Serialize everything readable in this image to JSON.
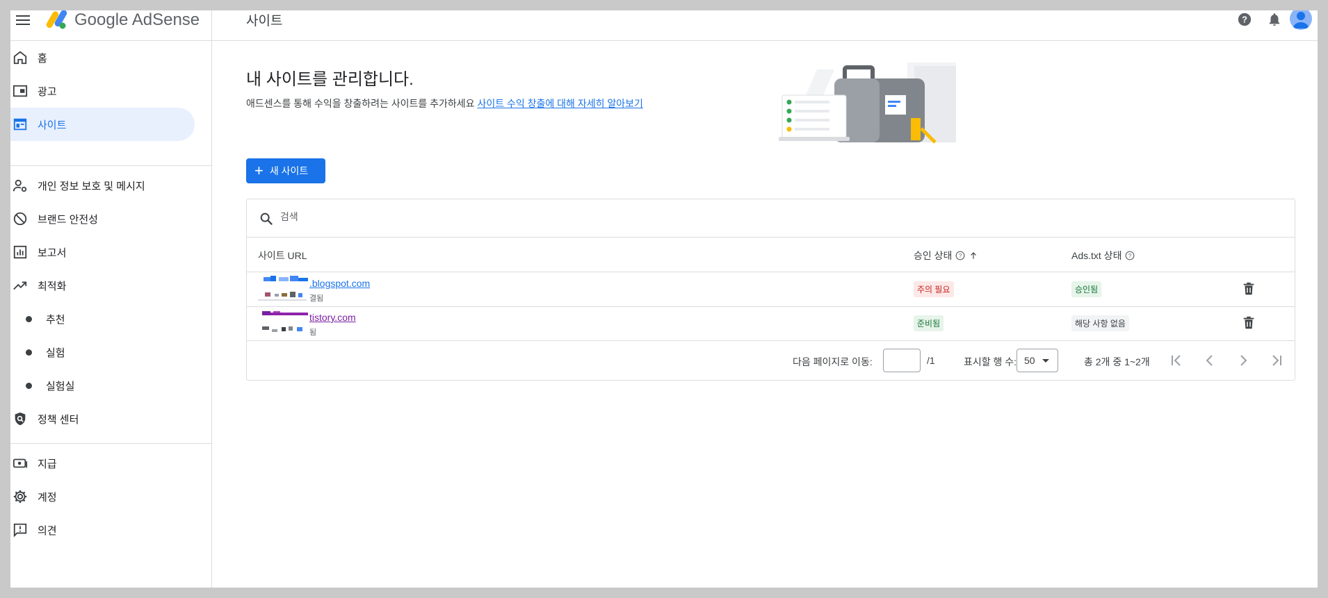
{
  "header": {
    "app_name": "Google AdSense",
    "page_title": "사이트"
  },
  "sidebar": {
    "items": [
      {
        "label": "홈",
        "icon": "home-icon"
      },
      {
        "label": "광고",
        "icon": "ads-icon"
      },
      {
        "label": "사이트",
        "icon": "sites-icon",
        "active": true
      },
      {
        "label": "개인 정보 보호 및 메시지",
        "icon": "privacy-messaging-icon"
      },
      {
        "label": "브랜드 안전성",
        "icon": "block-icon"
      },
      {
        "label": "보고서",
        "icon": "reports-icon"
      },
      {
        "label": "최적화",
        "icon": "trending-up-icon"
      },
      {
        "label": "추천"
      },
      {
        "label": "실험"
      },
      {
        "label": "실험실"
      },
      {
        "label": "정책 센터",
        "icon": "policy-shield-icon"
      },
      {
        "label": "지급",
        "icon": "payments-icon"
      },
      {
        "label": "계정",
        "icon": "gear-icon"
      },
      {
        "label": "의견",
        "icon": "feedback-icon"
      }
    ]
  },
  "main": {
    "heading": "내 사이트를 관리합니다.",
    "description": "애드센스를 통해 수익을 창출하려는 사이트를 추가하세요 ",
    "learn_more_link": "사이트 수익 창출에 대해 자세히 알아보기",
    "new_site_button": "새 사이트"
  },
  "table": {
    "search_placeholder": "검색",
    "columns": {
      "url": "사이트 URL",
      "approval": "승인 상태",
      "adstxt": "Ads.txt 상태"
    },
    "rows": [
      {
        "url": ".blogspot.com",
        "sub": "결됨",
        "approval": "주의 필요",
        "approval_color": "#c5221f",
        "adstxt": "승인됨",
        "adstxt_color": "#137333"
      },
      {
        "url": "tistory.com",
        "sub": "됨",
        "approval": "준비됨",
        "approval_color": "#137333",
        "adstxt": "해당 사항 없음",
        "adstxt_color": "#3c4043"
      }
    ],
    "pagination": {
      "goto_label": "다음 페이지로 이동:",
      "total_pages": "/1",
      "rows_label": "표시할 행 수:",
      "rows_per_page": "50",
      "range": "총 2개 중 1~2개"
    }
  },
  "colors": {
    "accent": "#1a73e8",
    "active_bg": "#e8f0fe"
  }
}
